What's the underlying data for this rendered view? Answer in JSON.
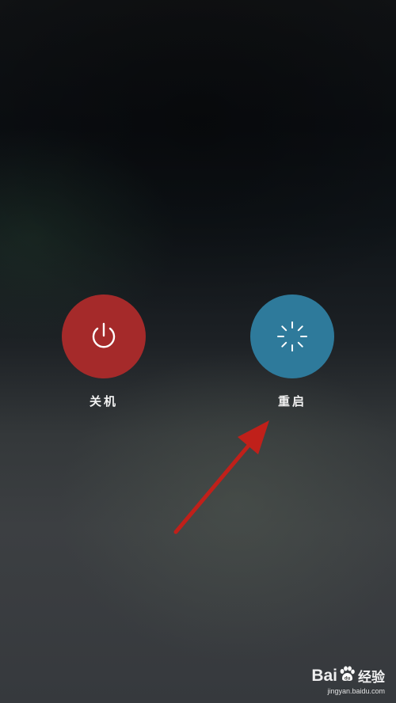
{
  "power_menu": {
    "shutdown": {
      "label": "关机",
      "icon": "power-icon",
      "color": "#a52a2a"
    },
    "restart": {
      "label": "重启",
      "icon": "loading-spinner-icon",
      "color": "#2e7a9b"
    }
  },
  "annotation": {
    "icon": "red-arrow-icon",
    "color": "#c0201a"
  },
  "watermark": {
    "logo_text": "Bai",
    "logo_suffix": "经验",
    "url": "jingyan.baidu.com"
  }
}
